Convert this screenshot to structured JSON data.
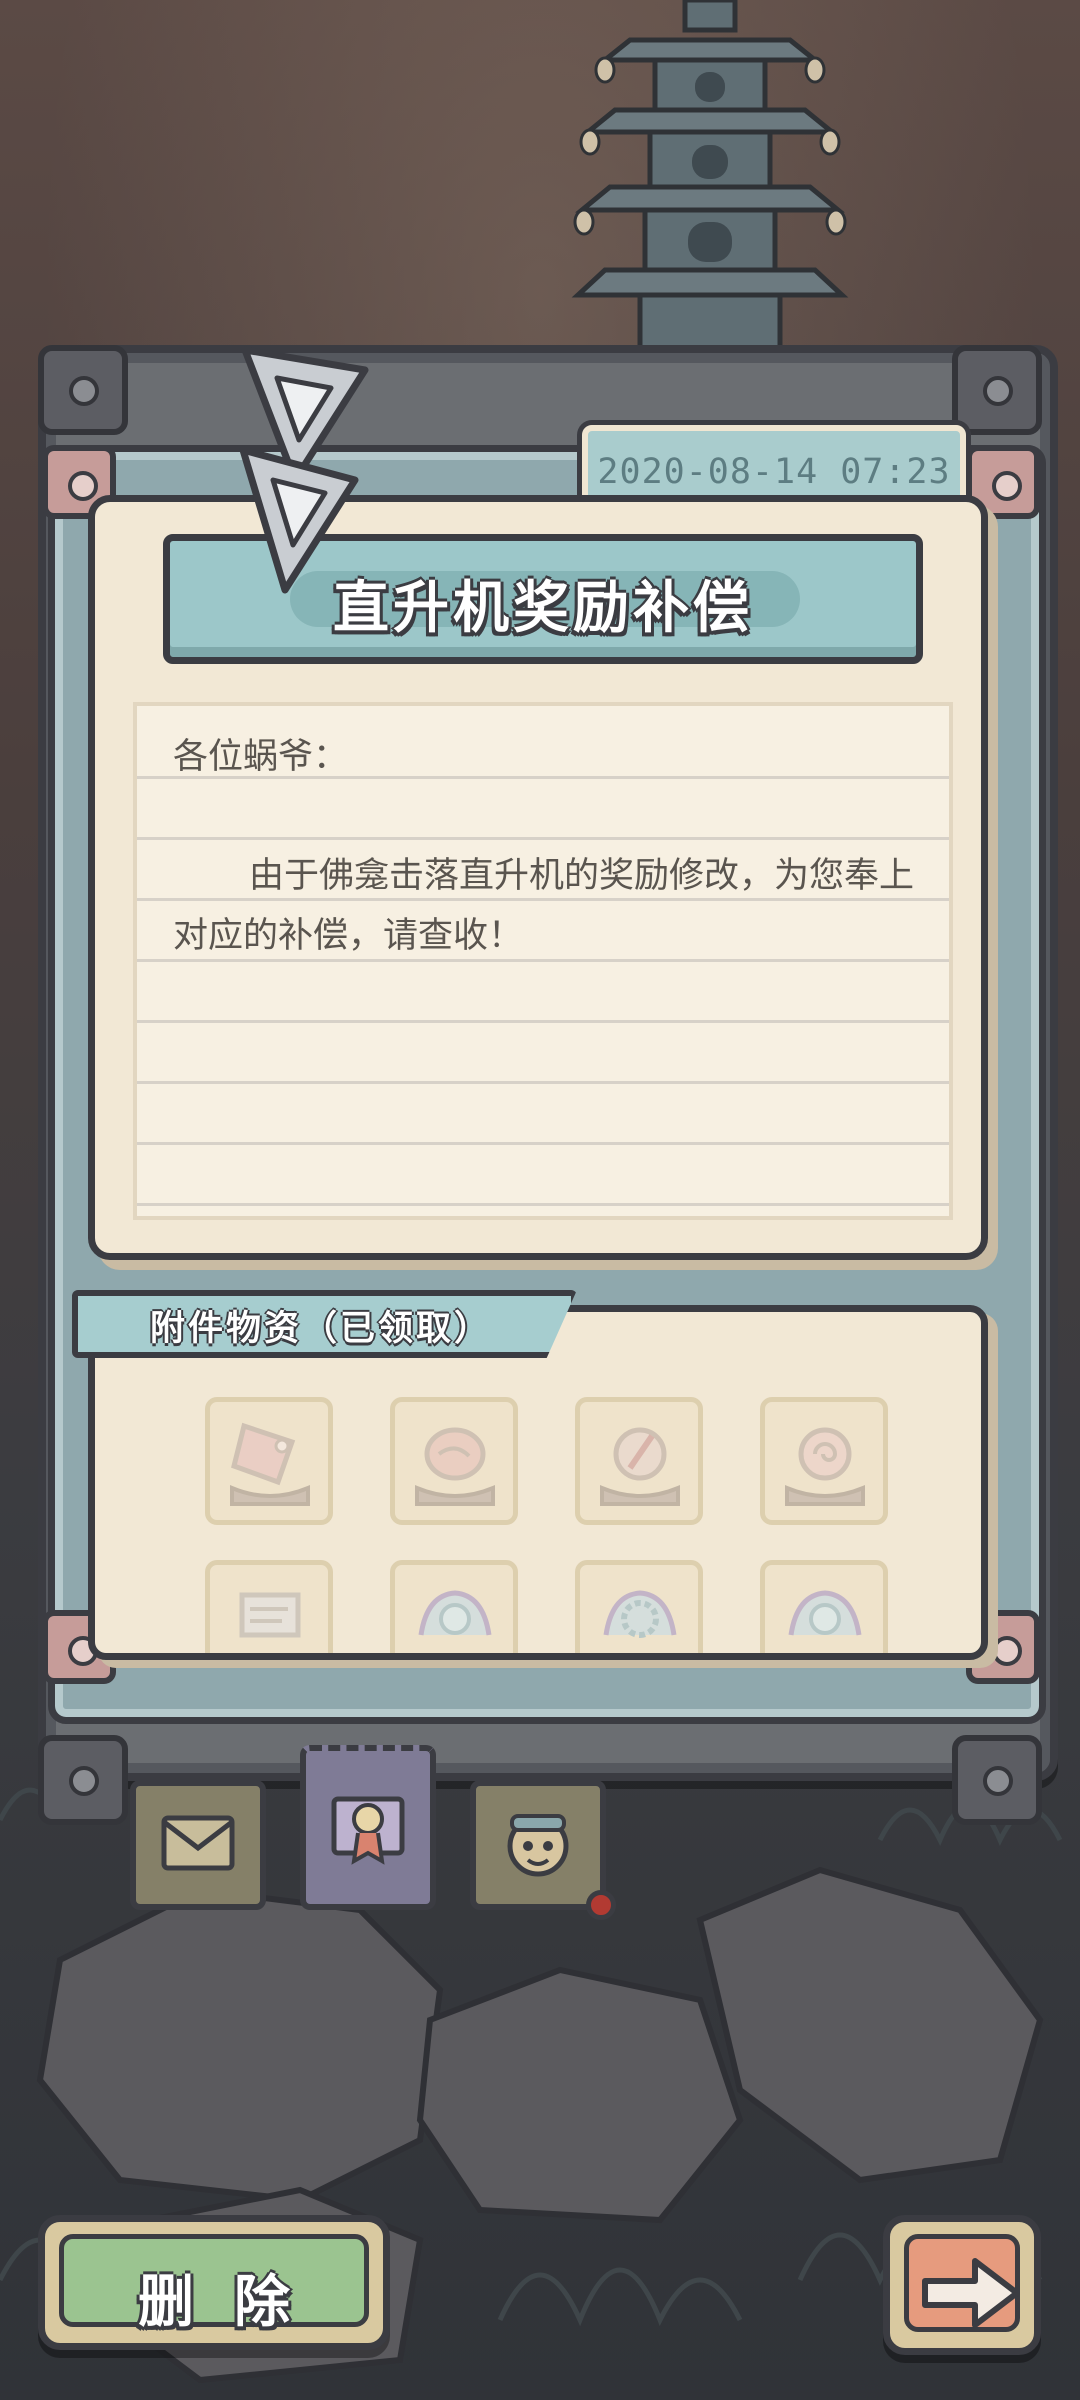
{
  "mail": {
    "date": "2020-08-14 07:23",
    "title": "直升机奖励补偿",
    "greeting": "各位蜗爷：",
    "body": "由于佛龛击落直升机的奖励修改，为您奉上对应的补偿，请查收！"
  },
  "attachments": {
    "label": "附件物资（已领取）",
    "status": "claimed",
    "items": [
      {
        "icon": "ticket-icon"
      },
      {
        "icon": "meat-icon"
      },
      {
        "icon": "compass-icon"
      },
      {
        "icon": "snail-shell-icon"
      },
      {
        "icon": "scroll-icon"
      },
      {
        "icon": "orb-icon"
      },
      {
        "icon": "gear-orb-icon"
      },
      {
        "icon": "orb-icon"
      }
    ]
  },
  "tabs": [
    {
      "icon": "envelope-icon",
      "active": false
    },
    {
      "icon": "reward-envelope-icon",
      "active": true
    },
    {
      "icon": "snail-face-icon",
      "active": false,
      "has_notification": true
    }
  ],
  "actions": {
    "delete_label": "删除",
    "next_icon": "arrow-right-icon"
  },
  "colors": {
    "banner": "#9cc7c9",
    "paper": "#f2e8d5",
    "delete_button": "#9bc490",
    "next_button": "#e69b7e",
    "notification": "#b23a32"
  }
}
